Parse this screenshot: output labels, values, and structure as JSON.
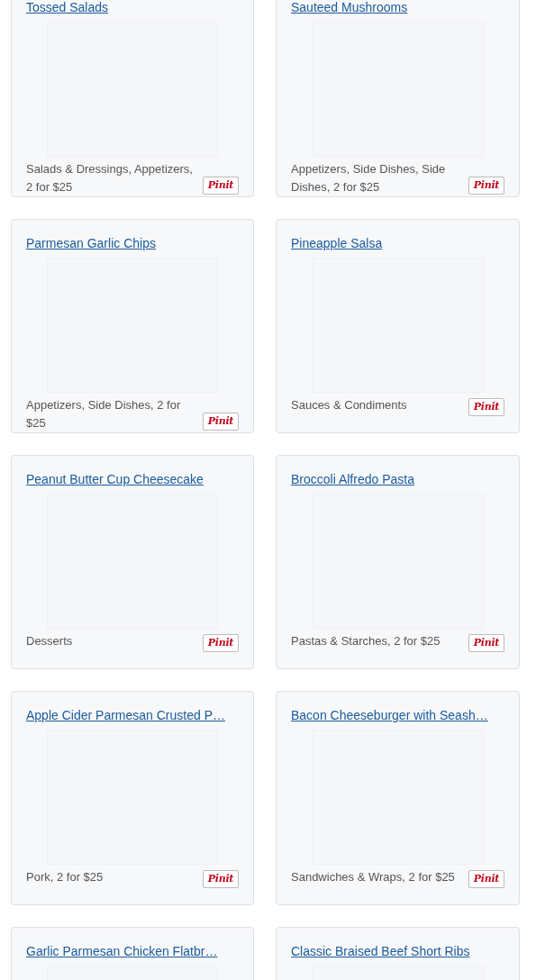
{
  "recipes": [
    {
      "title": "Tossed Salads",
      "categories": "Salads & Dressings, Appetizers, 2 for $25",
      "pin": "Pinit"
    },
    {
      "title": "Sauteed Mushrooms",
      "categories": "Appetizers, Side Dishes, Side Dishes, 2 for $25",
      "pin": "Pinit"
    },
    {
      "title": "Parmesan Garlic Chips",
      "categories": "Appetizers, Side Dishes, 2 for $25",
      "pin": "Pinit"
    },
    {
      "title": "Pineapple Salsa",
      "categories": "Sauces & Condiments",
      "pin": "Pinit"
    },
    {
      "title": "Peanut Butter Cup Cheesecake",
      "categories": "Desserts",
      "pin": "Pinit"
    },
    {
      "title": "Broccoli Alfredo Pasta",
      "categories": "Pastas & Starches, 2 for $25",
      "pin": "Pinit"
    },
    {
      "title": "Apple Cider Parmesan Crusted P…",
      "categories": "Pork, 2 for $25",
      "pin": "Pinit"
    },
    {
      "title": "Bacon Cheeseburger with Seash…",
      "categories": "Sandwiches & Wraps, 2 for $25",
      "pin": "Pinit"
    },
    {
      "title": "Garlic Parmesan Chicken Flatbr…"
    },
    {
      "title": "Classic Braised Beef Short Ribs"
    }
  ]
}
